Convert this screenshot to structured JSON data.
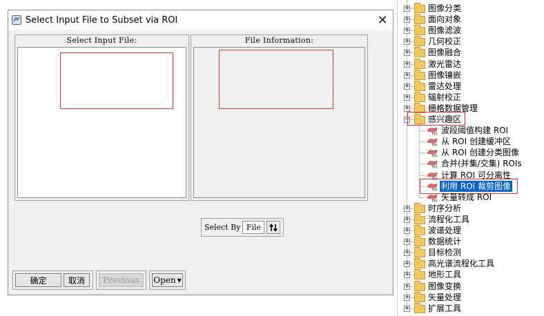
{
  "dialog": {
    "title": "Select Input File to Subset via ROI",
    "close_glyph": "✕",
    "input_group_title": "Select Input File:",
    "info_group_title": "File Information:",
    "select_by_label": "Select By",
    "select_by_value": "File",
    "sort_icon": "sort-toggle-icon",
    "buttons": {
      "ok": "确定",
      "cancel": "取消",
      "previous": "Previous",
      "open": "Open",
      "open_arrow": "▾"
    }
  },
  "tree": {
    "items": [
      {
        "label": "图像分类",
        "type": "folder",
        "expanded": false
      },
      {
        "label": "面向对象",
        "type": "folder",
        "expanded": false
      },
      {
        "label": "图像滤波",
        "type": "folder",
        "expanded": false
      },
      {
        "label": "几何校正",
        "type": "folder",
        "expanded": false
      },
      {
        "label": "图像融合",
        "type": "folder",
        "expanded": false
      },
      {
        "label": "激光雷达",
        "type": "folder",
        "expanded": false
      },
      {
        "label": "图像镶嵌",
        "type": "folder",
        "expanded": false
      },
      {
        "label": "雷达处理",
        "type": "folder",
        "expanded": false
      },
      {
        "label": "辐射校正",
        "type": "folder",
        "expanded": false
      },
      {
        "label": "栅格数据管理",
        "type": "folder",
        "expanded": false
      },
      {
        "label": "感兴趣区",
        "type": "folder",
        "expanded": true
      },
      {
        "label": "波段阈值构建 ROI",
        "type": "tool"
      },
      {
        "label": "从 ROI 创建缓冲区",
        "type": "tool"
      },
      {
        "label": "从 ROI 创建分类图像",
        "type": "tool"
      },
      {
        "label": "合并(并集/交集) ROIs",
        "type": "tool"
      },
      {
        "label": "计算 ROI 可分离性",
        "type": "tool"
      },
      {
        "label": "利用 ROI 裁剪图像",
        "type": "tool",
        "selected": true
      },
      {
        "label": "矢量转成 ROI",
        "type": "tool"
      },
      {
        "label": "时序分析",
        "type": "folder",
        "expanded": false
      },
      {
        "label": "流程化工具",
        "type": "folder",
        "expanded": false
      },
      {
        "label": "波谱处理",
        "type": "folder",
        "expanded": false
      },
      {
        "label": "数据统计",
        "type": "folder",
        "expanded": false
      },
      {
        "label": "目标检测",
        "type": "folder",
        "expanded": false
      },
      {
        "label": "高光谱流程化工具",
        "type": "folder",
        "expanded": false
      },
      {
        "label": "地形工具",
        "type": "folder",
        "expanded": false
      },
      {
        "label": "图像变换",
        "type": "folder",
        "expanded": false
      },
      {
        "label": "矢量处理",
        "type": "folder",
        "expanded": false
      },
      {
        "label": "扩展工具",
        "type": "folder",
        "expanded": false
      }
    ],
    "expander_plus": "+",
    "expander_minus": "−"
  },
  "colors": {
    "selection": "#0a64c8",
    "annotation": "#e03030",
    "folder": "#f4c860"
  }
}
